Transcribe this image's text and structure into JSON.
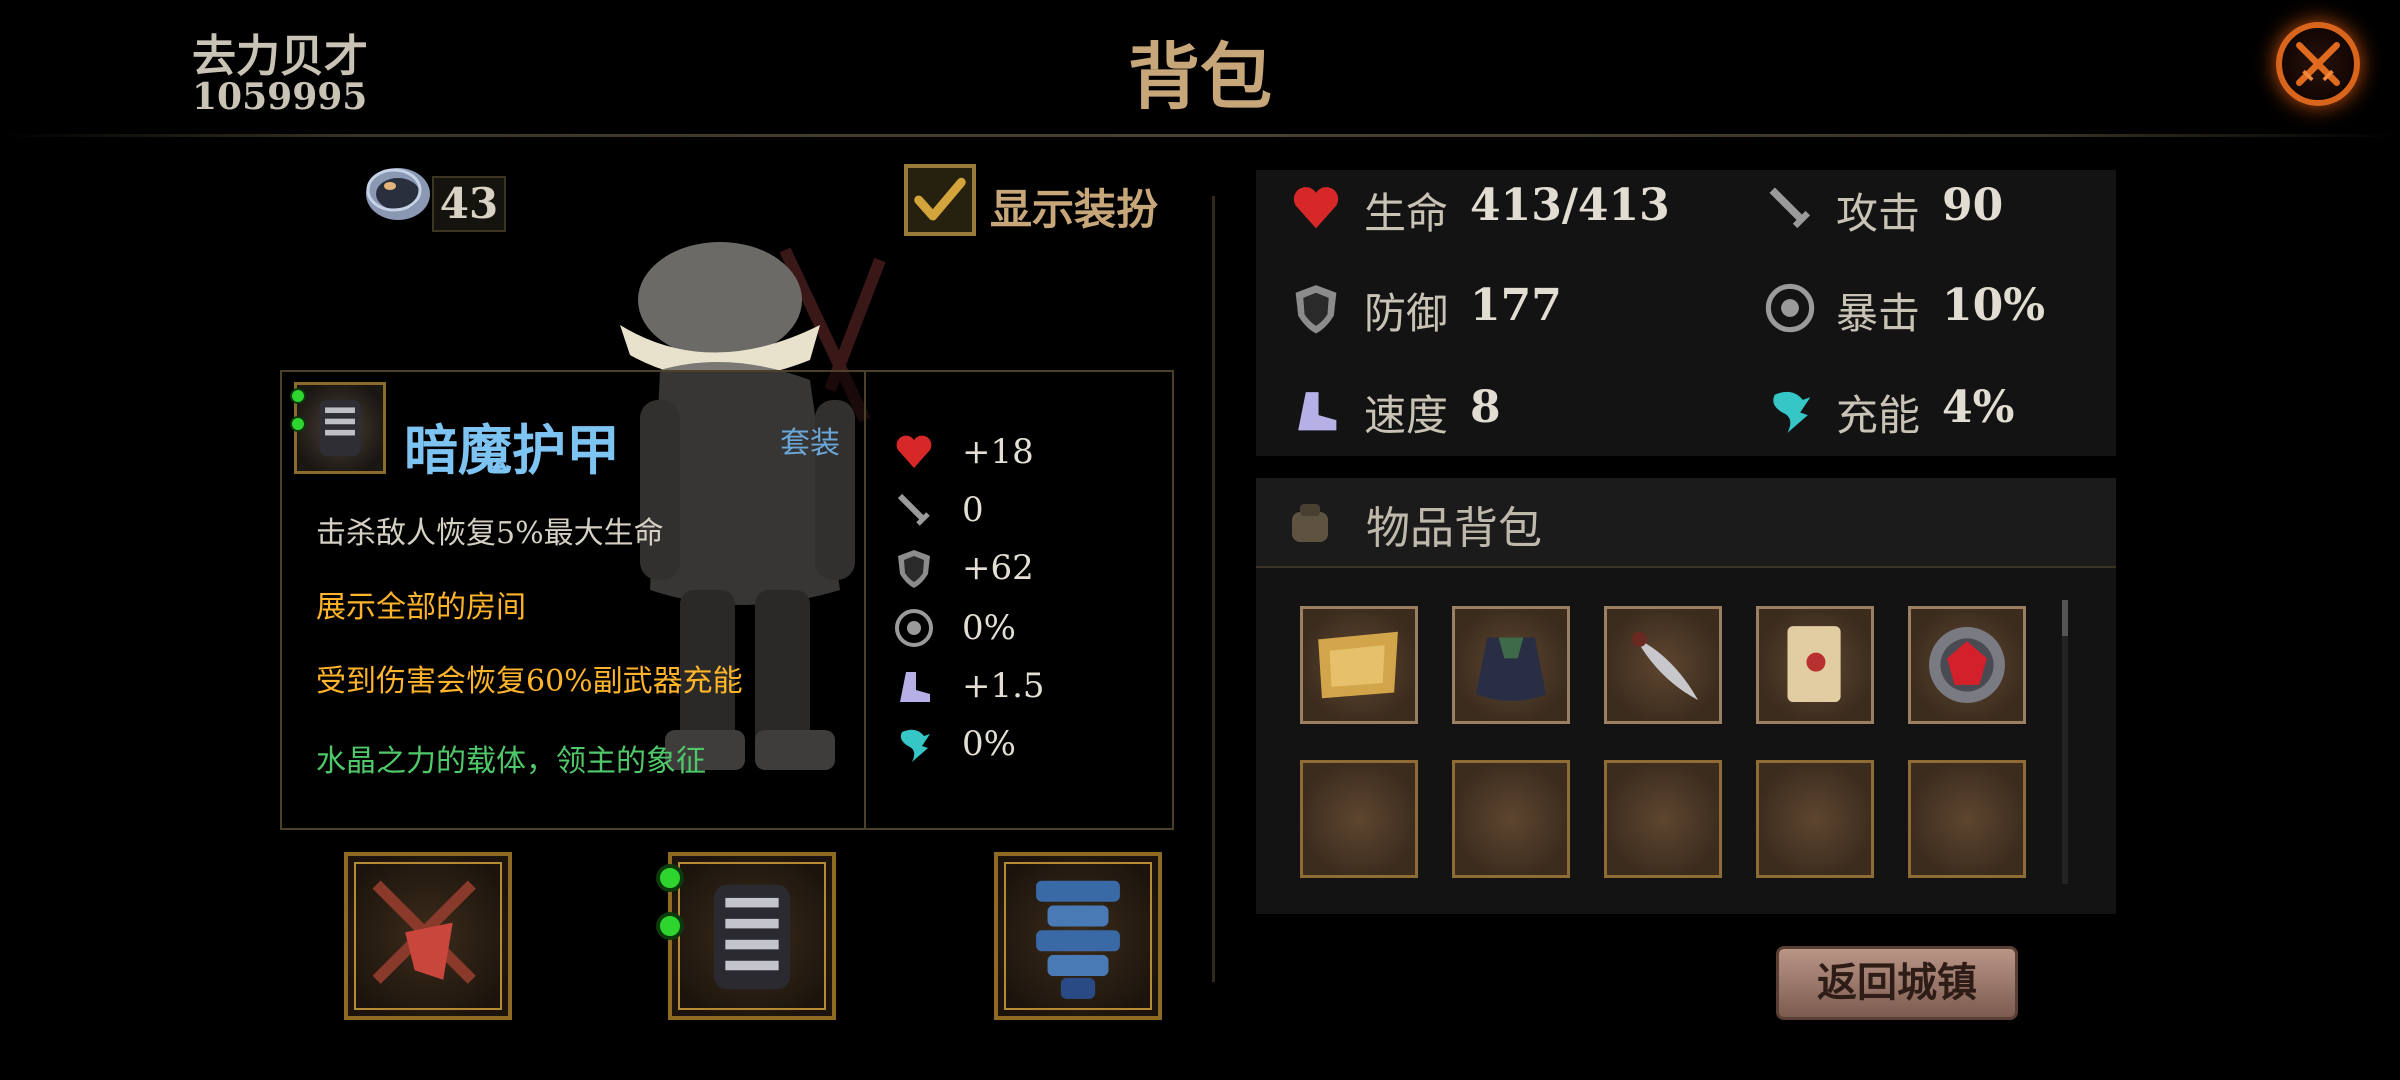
{
  "header": {
    "player_name": "去力贝才",
    "player_id": "1059995",
    "title": "背包",
    "close_icon": "close-crossed-swords-icon"
  },
  "left": {
    "currency_count": "43",
    "currency_icon": "ring-icon",
    "show_outfit_label": "显示装扮",
    "show_outfit_checked": true,
    "item": {
      "name": "暗魔护甲",
      "set_label": "套装",
      "icon": "dark-armor-icon",
      "sockets": 2,
      "descriptions": [
        {
          "text": "击杀敌人恢复5%最大生命",
          "color": "#d6d0c4"
        },
        {
          "text": "展示全部的房间",
          "color": "#ffb42a"
        },
        {
          "text": "受到伤害会恢复60%副武器充能",
          "color": "#ffb42a"
        },
        {
          "text": "水晶之力的载体，领主的象征",
          "color": "#4fc86a"
        }
      ],
      "stats": [
        {
          "icon": "heart-icon",
          "value": "+18"
        },
        {
          "icon": "sword-icon",
          "value": "0"
        },
        {
          "icon": "shield-icon",
          "value": "+62"
        },
        {
          "icon": "crit-icon",
          "value": "0%"
        },
        {
          "icon": "boot-icon",
          "value": "+1.5"
        },
        {
          "icon": "charge-icon",
          "value": "0%"
        }
      ]
    },
    "equipment": [
      {
        "icon": "crossed-weapons-icon",
        "sockets": 0
      },
      {
        "icon": "dark-armor-icon",
        "sockets": 2
      },
      {
        "icon": "blue-totem-icon",
        "sockets": 0
      }
    ]
  },
  "stats": [
    {
      "icon": "heart-icon",
      "name": "生命",
      "value": "413/413"
    },
    {
      "icon": "sword-icon",
      "name": "攻击",
      "value": "90"
    },
    {
      "icon": "shield-icon",
      "name": "防御",
      "value": "177"
    },
    {
      "icon": "crit-icon",
      "name": "暴击",
      "value": "10%"
    },
    {
      "icon": "boot-icon",
      "name": "速度",
      "value": "8"
    },
    {
      "icon": "charge-icon",
      "name": "充能",
      "value": "4%"
    }
  ],
  "inventory": {
    "title": "物品背包",
    "icon": "bag-icon",
    "slots": [
      {
        "icon": "map-scroll-icon"
      },
      {
        "icon": "dark-cloak-icon"
      },
      {
        "icon": "dagger-icon"
      },
      {
        "icon": "treasure-map-icon"
      },
      {
        "icon": "red-gem-gear-icon"
      },
      {
        "icon": ""
      },
      {
        "icon": ""
      },
      {
        "icon": ""
      },
      {
        "icon": ""
      },
      {
        "icon": ""
      }
    ]
  },
  "return_button": "返回城镇"
}
